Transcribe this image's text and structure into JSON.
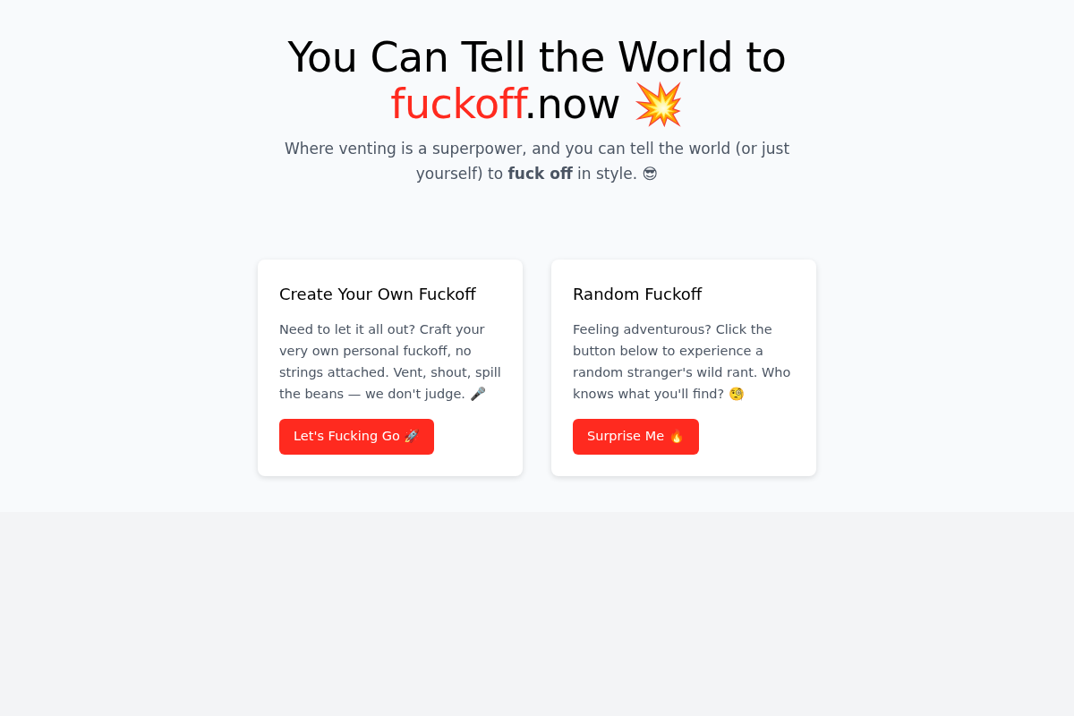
{
  "hero": {
    "title_lead": "You Can Tell the World to",
    "title_highlight": "fuckoff",
    "title_tail": ".now 💥",
    "subtitle": "Where venting is a superpower, and you can tell the world (or just yourself) to **fuck off** in style. 😎"
  },
  "cards": [
    {
      "title": "Create Your Own Fuckoff",
      "body": "Need to let it all out? Craft your very own personal fuckoff, no strings attached. Vent, shout, spill the beans — we don't judge. 🎤",
      "button": "Let's Fucking Go 🚀"
    },
    {
      "title": "Random Fuckoff",
      "body": "Feeling adventurous? Click the button below to experience a random stranger's wild rant. Who knows what you'll find? 🧐",
      "button": "Surprise Me 🔥"
    }
  ]
}
